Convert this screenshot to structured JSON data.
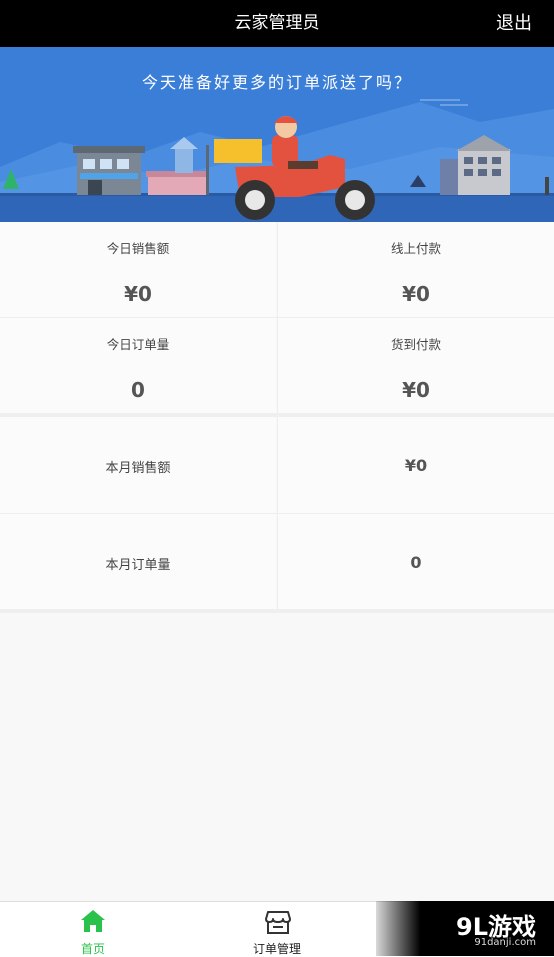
{
  "header": {
    "title": "云家管理员",
    "logout_label": "退出"
  },
  "banner": {
    "slogan": "今天准备好更多的订单派送了吗？"
  },
  "today": {
    "sales_label": "今日销售额",
    "sales_value": "¥0",
    "online_label": "线上付款",
    "online_value": "¥0",
    "orders_label": "今日订单量",
    "orders_value": "0",
    "cod_label": "货到付款",
    "cod_value": "¥0"
  },
  "month": {
    "sales_label": "本月销售额",
    "sales_value": "¥0",
    "orders_label": "本月订单量",
    "orders_value": "0"
  },
  "nav": {
    "home_label": "首页",
    "home_icon": "home-icon",
    "orders_label": "订单管理",
    "orders_icon": "store-icon",
    "active_color": "#2bc24b"
  },
  "watermark": {
    "brand": "9L游戏",
    "domain": "91danji.com"
  }
}
